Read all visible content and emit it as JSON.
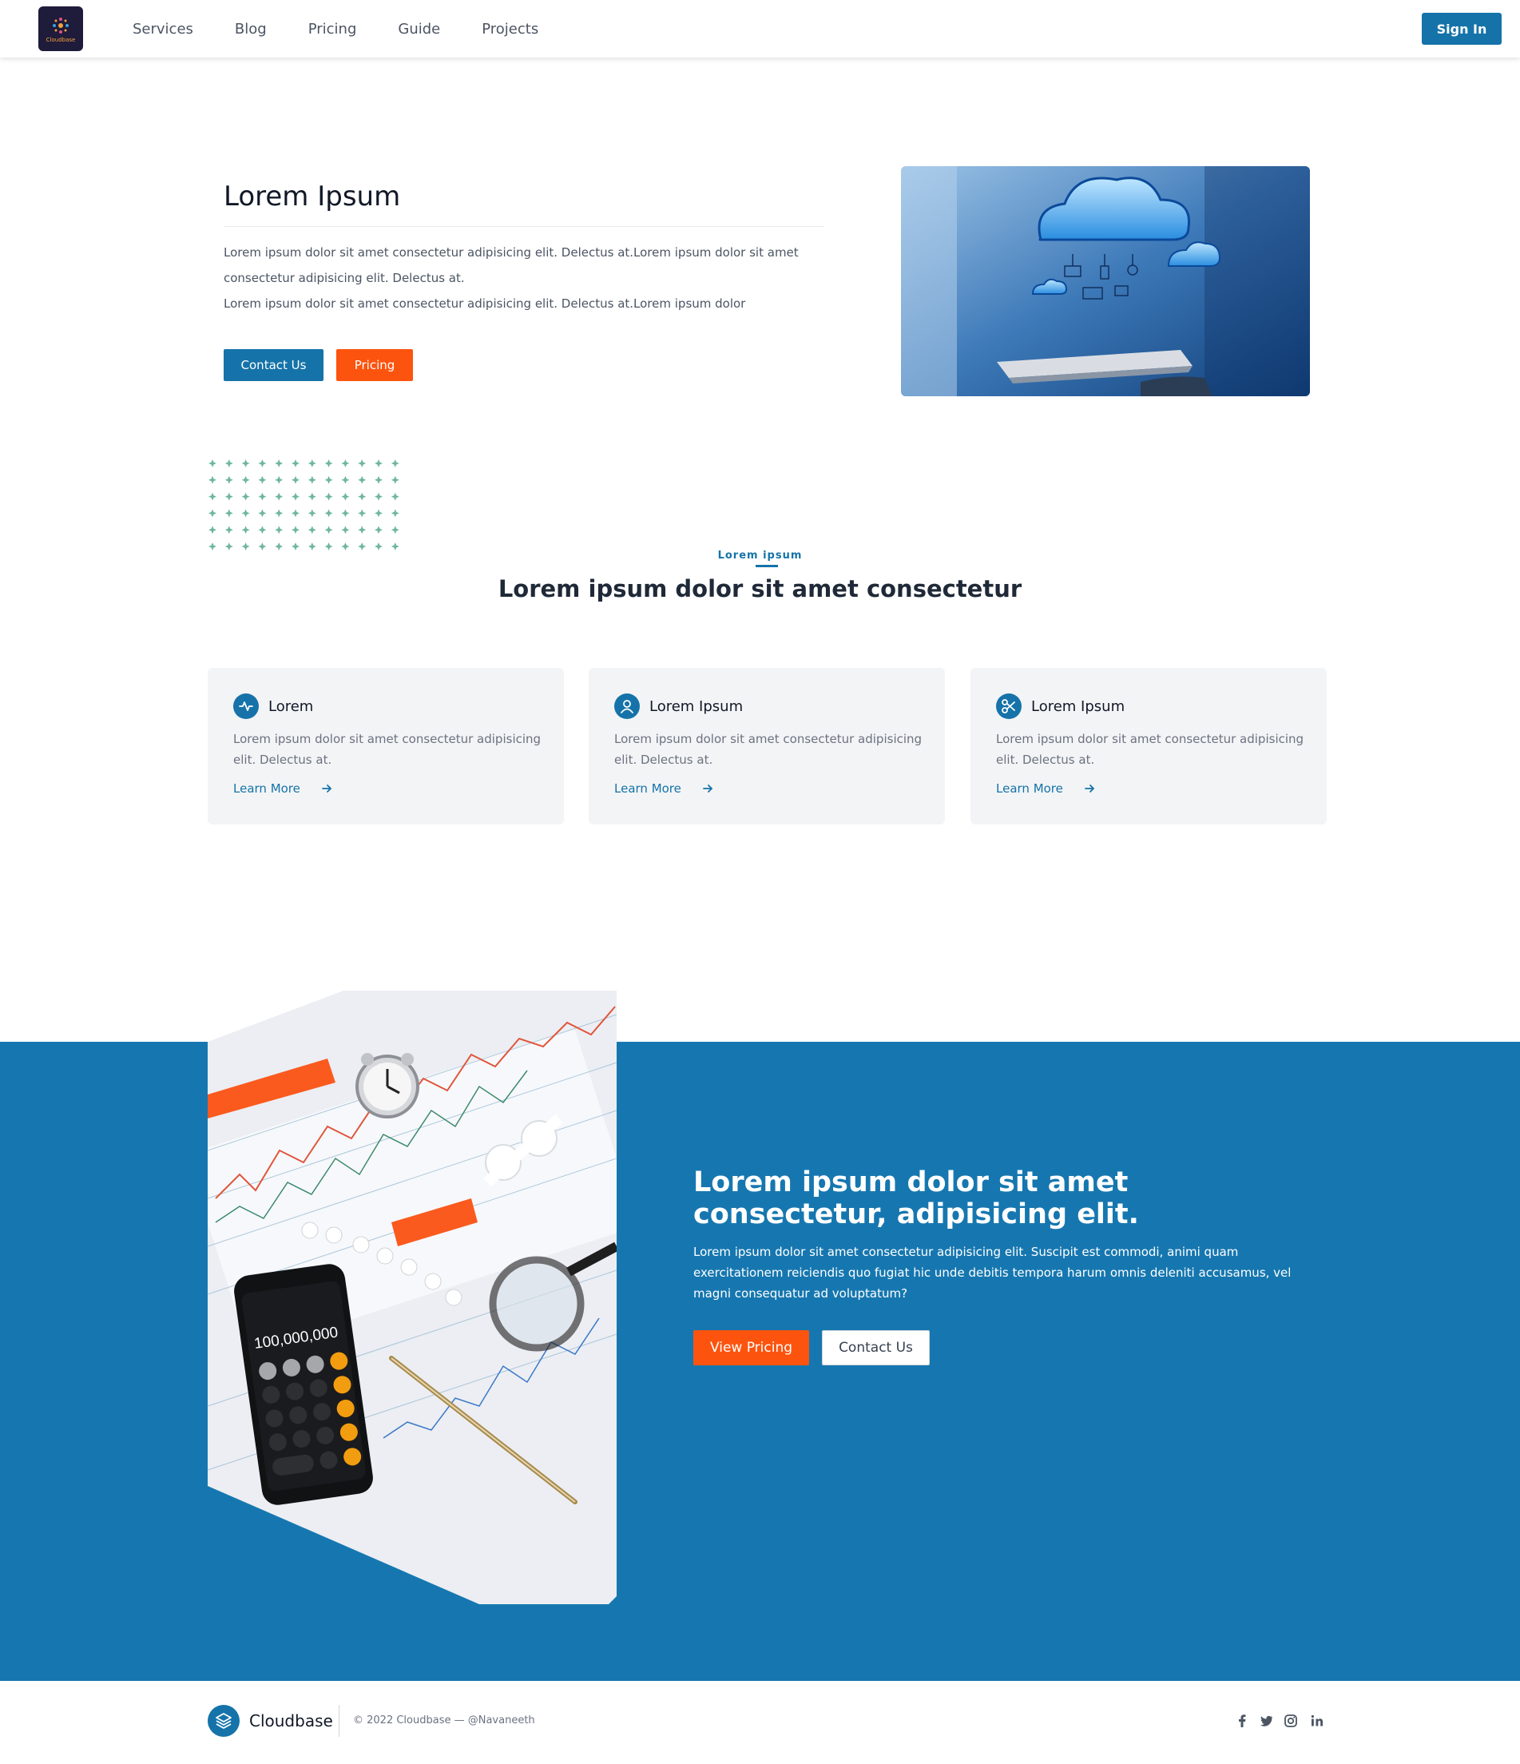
{
  "brand": {
    "name": "Cloudbase",
    "logo_text": "Cloudbase"
  },
  "nav": {
    "links": [
      "Services",
      "Blog",
      "Pricing",
      "Guide",
      "Projects"
    ],
    "signin": "Sign In"
  },
  "hero": {
    "title": "Lorem Ipsum",
    "lines": [
      "Lorem ipsum dolor sit amet consectetur adipisicing elit. Delectus at.Lorem ipsum dolor sit amet",
      "consectetur adipisicing elit. Delectus at.",
      "Lorem ipsum dolor sit amet consectetur adipisicing elit. Delectus at.Lorem ipsum dolor"
    ],
    "contact_label": "Contact Us",
    "pricing_label": "Pricing"
  },
  "features": {
    "eyebrow": "Lorem ipsum",
    "title": "Lorem ipsum dolor sit amet consectetur",
    "cards": [
      {
        "icon": "activity-icon",
        "title": "Lorem",
        "text": "Lorem ipsum dolor sit amet consectetur adipisicing elit. Delectus at.",
        "link": "Learn More"
      },
      {
        "icon": "user-icon",
        "title": "Lorem Ipsum",
        "text": "Lorem ipsum dolor sit amet consectetur adipisicing elit. Delectus at.",
        "link": "Learn More"
      },
      {
        "icon": "scissors-icon",
        "title": "Lorem Ipsum",
        "text": "Lorem ipsum dolor sit amet consectetur adipisicing elit. Delectus at.",
        "link": "Learn More"
      }
    ]
  },
  "cta": {
    "title": "Lorem ipsum dolor sit amet consectetur, adipisicing elit.",
    "text": "Lorem ipsum dolor sit amet consectetur adipisicing elit. Suscipit est commodi, animi quam exercitationem reiciendis quo fugiat hic unde debitis tempora harum omnis deleniti accusamus, vel magni consequatur ad voluptatum?",
    "primary_label": "View Pricing",
    "secondary_label": "Contact Us",
    "calculator_display": "100,000,000"
  },
  "footer": {
    "brand": "Cloudbase",
    "copyright": "© 2022 Cloudbase — @Navaneeth",
    "social": [
      "facebook-icon",
      "twitter-icon",
      "instagram-icon",
      "linkedin-icon"
    ]
  },
  "colors": {
    "primary": "#1573a9",
    "accent": "#fc540f",
    "band": "#1677b0",
    "card": "#f3f4f6",
    "dots": "#6fb6a0"
  }
}
